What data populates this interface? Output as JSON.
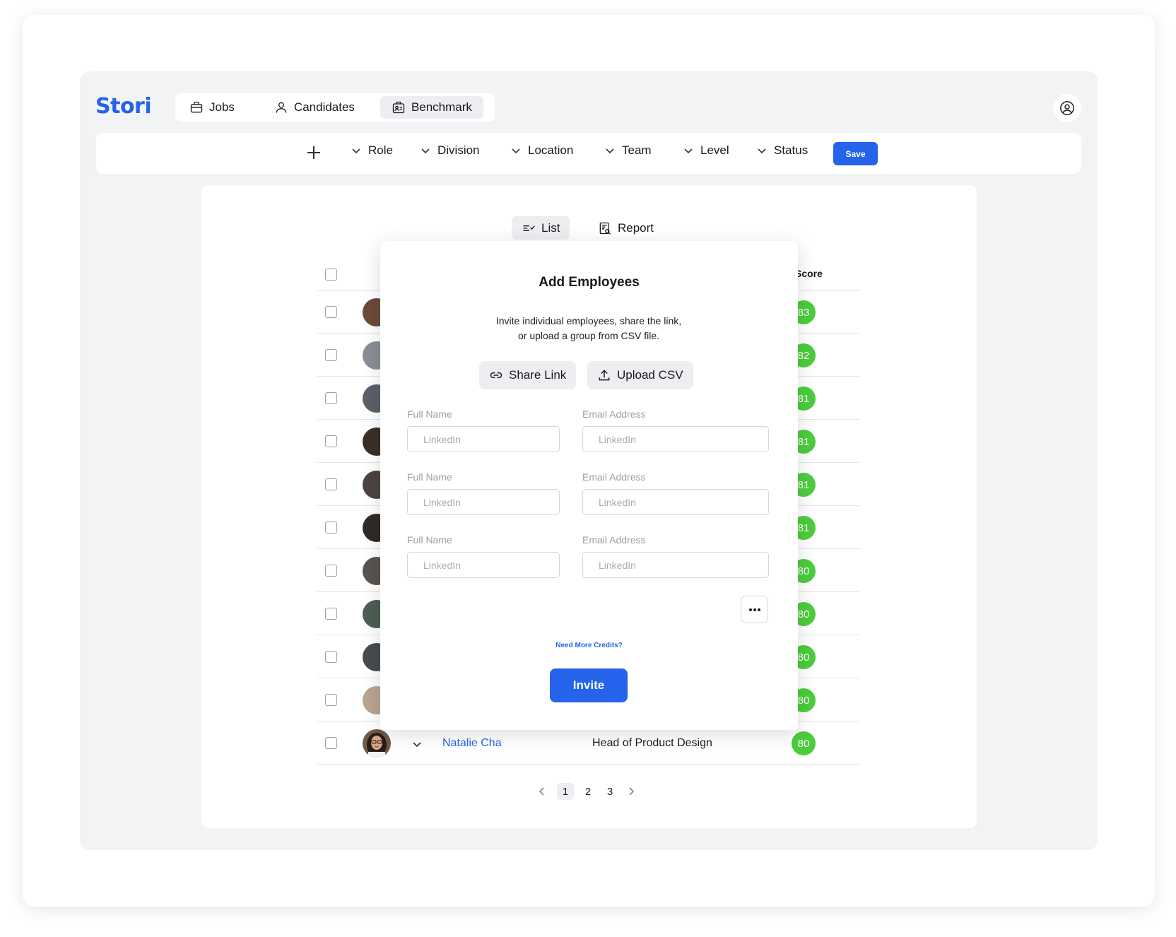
{
  "app": {
    "logo": "Stori"
  },
  "nav": {
    "items": [
      {
        "label": "Jobs",
        "icon": "briefcase-icon"
      },
      {
        "label": "Candidates",
        "icon": "user-icon"
      },
      {
        "label": "Benchmark",
        "icon": "benchmark-icon",
        "active": true
      }
    ]
  },
  "filters": {
    "items": [
      "Role",
      "Division",
      "Location",
      "Team",
      "Level",
      "Status"
    ],
    "save_label": "Save"
  },
  "view_tabs": {
    "list_label": "List",
    "report_label": "Report"
  },
  "table": {
    "score_header": "Score",
    "scores": [
      83,
      82,
      81,
      81,
      81,
      81,
      80,
      80,
      80,
      80,
      80
    ],
    "last_row": {
      "name": "Natalie Cha",
      "title": "Head of Product Design",
      "score": 80
    }
  },
  "pagination": {
    "pages": [
      "1",
      "2",
      "3"
    ],
    "current": "1"
  },
  "modal": {
    "title": "Add Employees",
    "description_line1": "Invite individual employees, share the link,",
    "description_line2": "or upload a group from CSV file.",
    "share_link_label": "Share Link",
    "upload_csv_label": "Upload CSV",
    "full_name_label": "Full Name",
    "email_label": "Email Address",
    "input_placeholder": "LinkedIn",
    "credits_link": "Need More Credits?",
    "invite_label": "Invite"
  },
  "colors": {
    "accent": "#2563eb",
    "score_green": "#4ccd3c",
    "app_bg": "#f2f3f5"
  }
}
